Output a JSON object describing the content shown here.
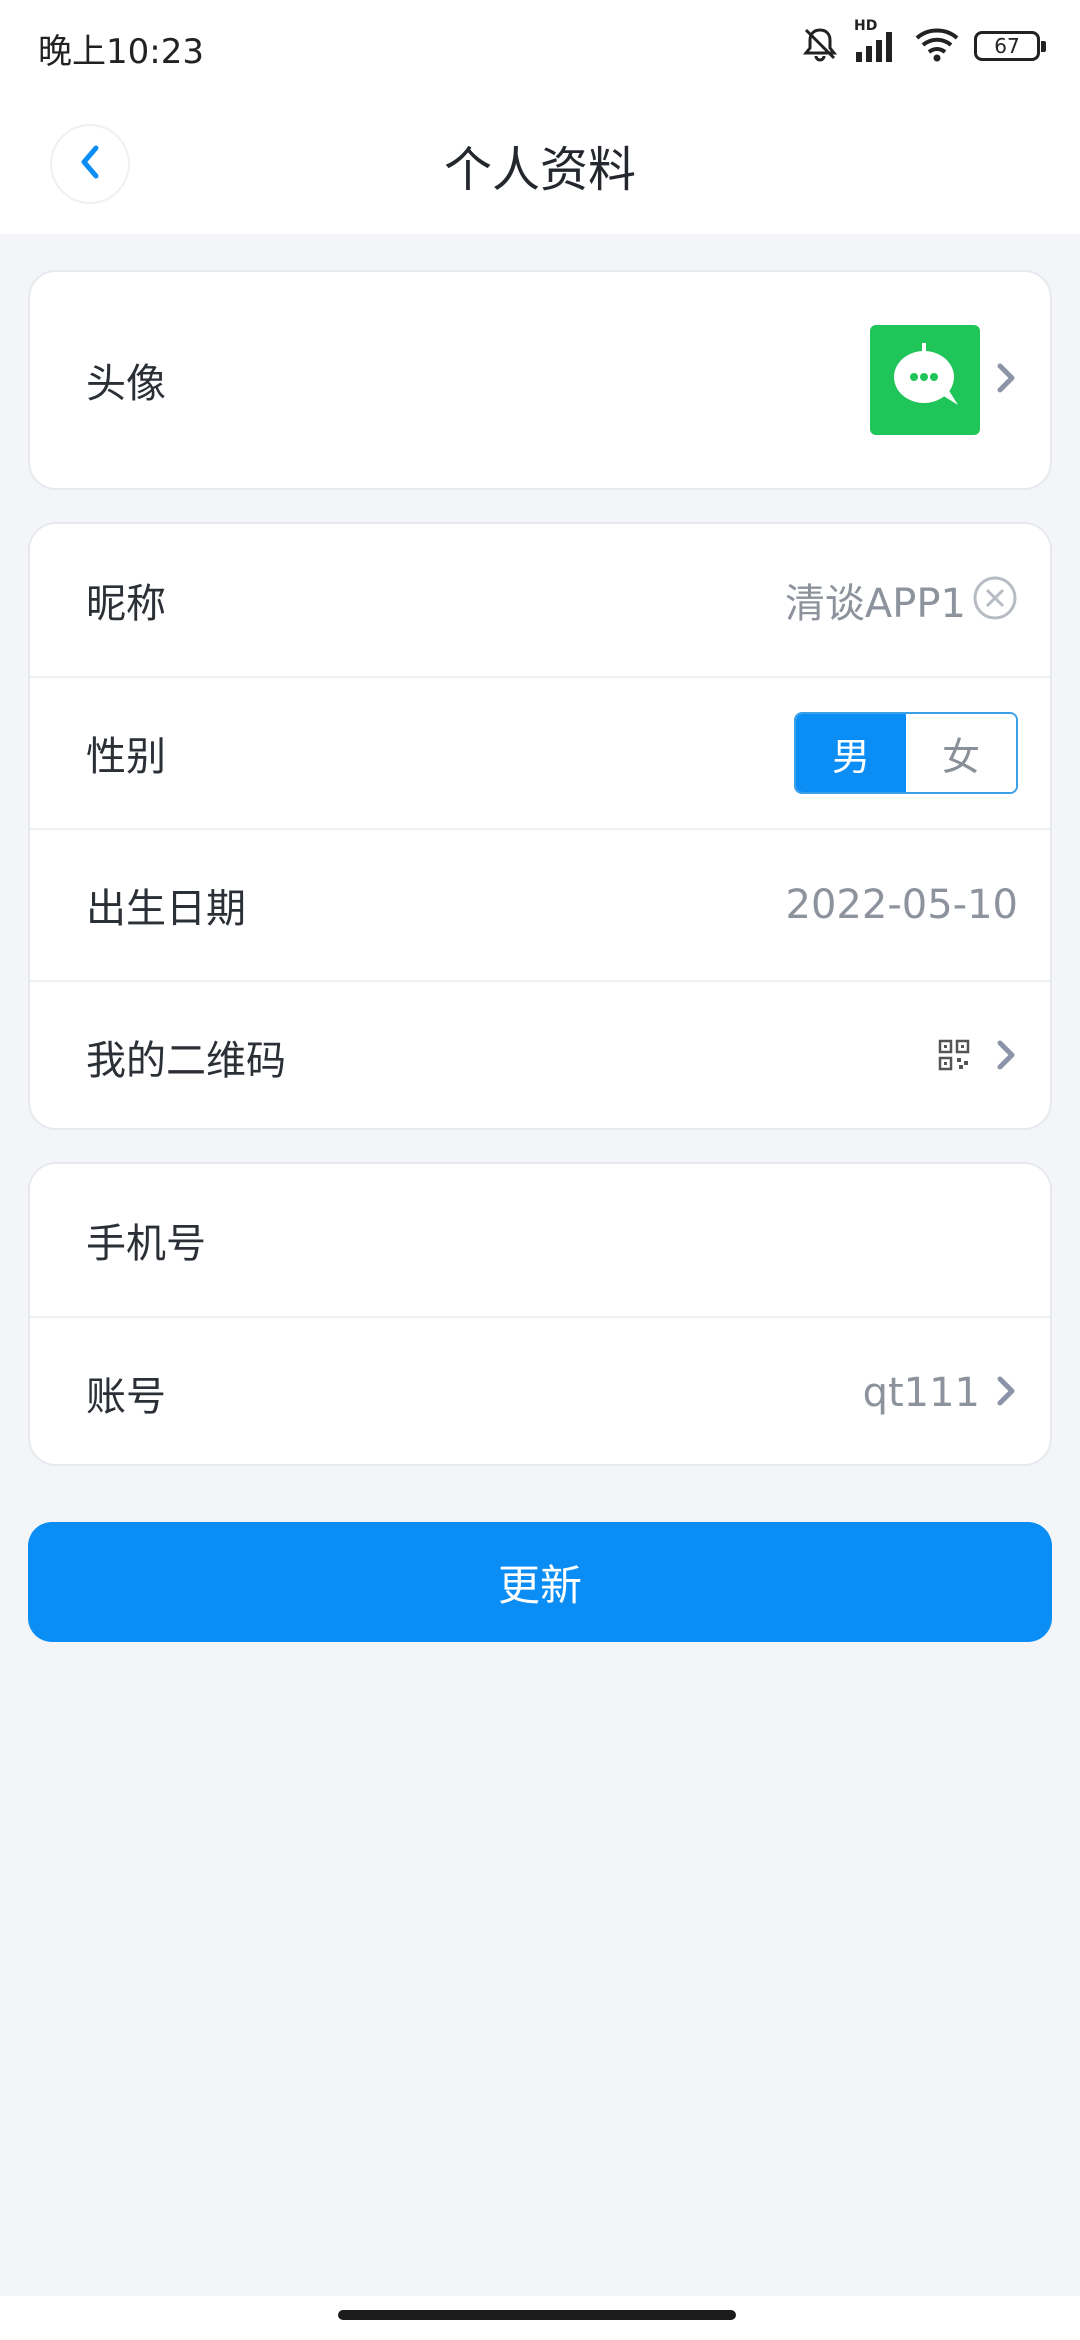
{
  "status_bar": {
    "time": "晚上10:23",
    "battery": "67",
    "network": "HD"
  },
  "header": {
    "title": "个人资料"
  },
  "profile": {
    "avatar_label": "头像",
    "nickname_label": "昵称",
    "nickname_value": "清谈APP1",
    "gender_label": "性别",
    "gender_options": [
      "男",
      "女"
    ],
    "gender_selected": "男",
    "birthdate_label": "出生日期",
    "birthdate_value": "2022-05-10",
    "qrcode_label": "我的二维码",
    "phone_label": "手机号",
    "phone_value": "",
    "account_label": "账号",
    "account_value": "qt111"
  },
  "actions": {
    "update_label": "更新"
  },
  "colors": {
    "accent": "#0a8ef5",
    "avatar_green": "#20c55a",
    "background": "#f4f5f9"
  }
}
